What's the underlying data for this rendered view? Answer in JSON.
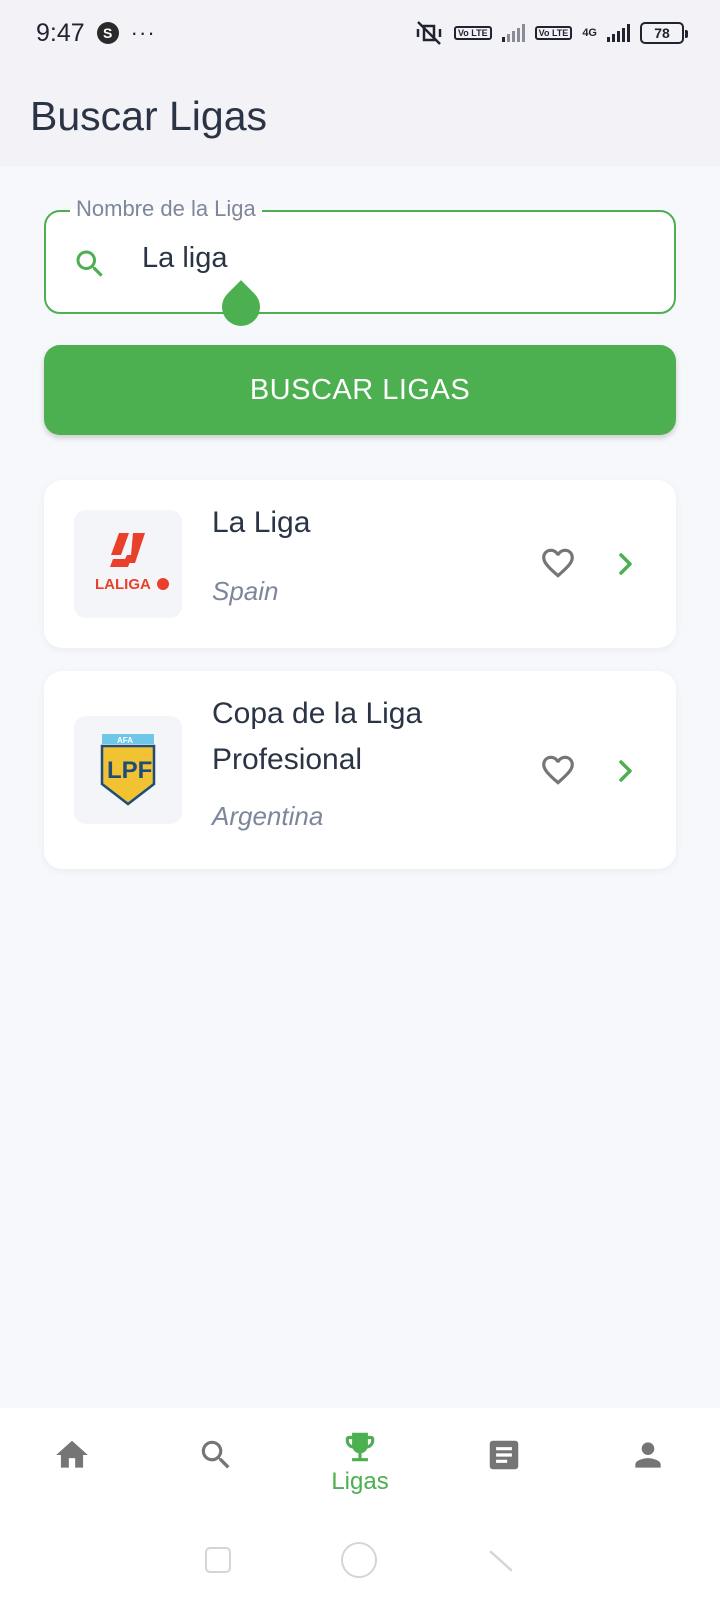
{
  "status_bar": {
    "time": "9:47",
    "app_badge": "S",
    "more": "···",
    "volte_1": "Vo LTE",
    "volte_2": "Vo LTE",
    "network": "4G",
    "battery": "78"
  },
  "app_bar": {
    "title": "Buscar Ligas"
  },
  "search": {
    "label": "Nombre de la Liga",
    "value": "La liga",
    "icon": "search-icon"
  },
  "search_button": {
    "label": "BUSCAR LIGAS"
  },
  "results": [
    {
      "name": "La Liga",
      "country": "Spain",
      "logo_text": "LALIGA",
      "favorite_icon": "heart-outline-icon",
      "open_icon": "chevron-right-icon"
    },
    {
      "name": "Copa de la Liga Profesional",
      "country": "Argentina",
      "logo_text": "LPF",
      "logo_top_text": "AFA",
      "favorite_icon": "heart-outline-icon",
      "open_icon": "chevron-right-icon"
    }
  ],
  "bottom_nav": {
    "items": [
      {
        "icon": "home-icon",
        "label": ""
      },
      {
        "icon": "search-icon",
        "label": ""
      },
      {
        "icon": "trophy-icon",
        "label": "Ligas",
        "active": true
      },
      {
        "icon": "article-icon",
        "label": ""
      },
      {
        "icon": "person-icon",
        "label": ""
      }
    ]
  },
  "colors": {
    "accent": "#4caf50",
    "text_primary": "#2b3445",
    "text_secondary": "#7e869c",
    "background": "#f7f8fc",
    "app_bar": "#f3f2f7",
    "icon_inactive": "#757575"
  }
}
